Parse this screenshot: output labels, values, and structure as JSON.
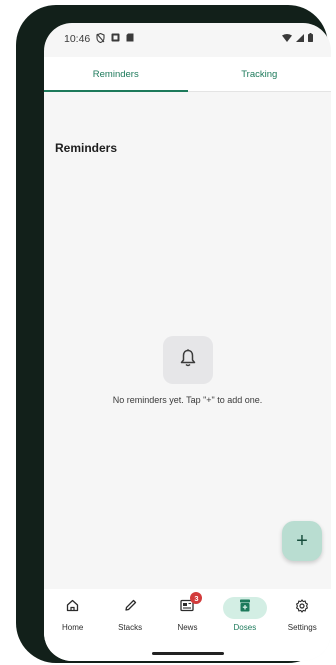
{
  "status_bar": {
    "time": "10:46",
    "left_icons": [
      "shield-off-icon",
      "app-notification-icon",
      "sd-card-icon"
    ],
    "right_icons": [
      "wifi-icon",
      "signal-icon",
      "battery-icon"
    ]
  },
  "tabs": [
    {
      "label": "Reminders",
      "active": true
    },
    {
      "label": "Tracking",
      "active": false
    }
  ],
  "section_title": "Reminders",
  "empty_state": {
    "icon": "bell-icon",
    "message": "No reminders yet. Tap \"+\" to add one."
  },
  "fab": {
    "label": "+",
    "icon": "plus-icon"
  },
  "bottom_nav": [
    {
      "label": "Home",
      "icon": "home-icon",
      "active": false
    },
    {
      "label": "Stacks",
      "icon": "pencil-icon",
      "active": false
    },
    {
      "label": "News",
      "icon": "news-icon",
      "active": false,
      "badge": "3"
    },
    {
      "label": "Doses",
      "icon": "pill-box-icon",
      "active": true
    },
    {
      "label": "Settings",
      "icon": "gear-icon",
      "active": false
    }
  ],
  "colors": {
    "accent": "#1d7a5b",
    "active_pill": "#d3eee4",
    "fab": "#b9ddd1",
    "badge": "#d23b3b",
    "frame": "#12201a"
  }
}
